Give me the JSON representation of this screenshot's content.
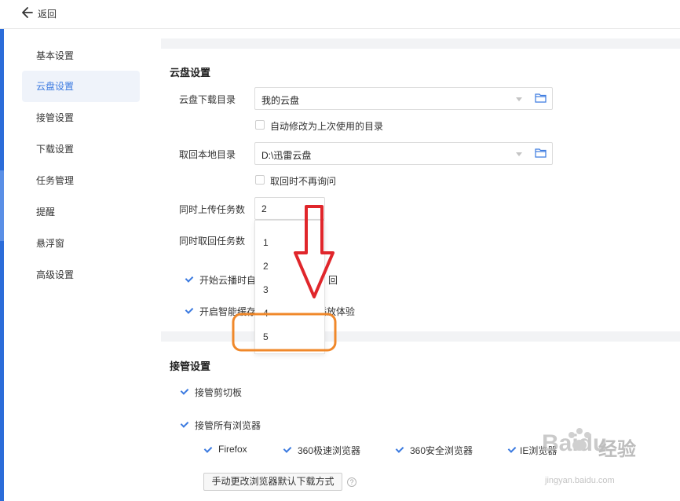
{
  "header": {
    "back_label": "返回"
  },
  "sidebar": {
    "items": [
      {
        "label": "基本设置",
        "active": false
      },
      {
        "label": "云盘设置",
        "active": true
      },
      {
        "label": "接管设置",
        "active": false
      },
      {
        "label": "下载设置",
        "active": false
      },
      {
        "label": "任务管理",
        "active": false
      },
      {
        "label": "提醒",
        "active": false
      },
      {
        "label": "悬浮窗",
        "active": false
      },
      {
        "label": "高级设置",
        "active": false
      }
    ]
  },
  "cloud": {
    "title": "云盘设置",
    "download_dir": {
      "label": "云盘下载目录",
      "value": "我的云盘"
    },
    "auto_modify": {
      "label": "自动修改为上次使用的目录",
      "checked": false
    },
    "local_dir": {
      "label": "取回本地目录",
      "value": "D:\\迅雷云盘"
    },
    "no_ask": {
      "label": "取回时不再询问",
      "checked": false
    },
    "upload_tasks": {
      "label": "同时上传任务数",
      "value": "2"
    },
    "retrieve_tasks": {
      "label": "同时取回任务数"
    },
    "start_play": {
      "label_left": "开始云播时自",
      "label_right": "回",
      "checked": true
    },
    "smart_cache": {
      "label_left": "开启智能缓存",
      "label_right": "播放体验",
      "checked": true
    },
    "dropdown_options": [
      "1",
      "2",
      "3",
      "4",
      "5"
    ]
  },
  "takeover": {
    "title": "接管设置",
    "clipboard": {
      "label": "接管剪切板",
      "checked": true
    },
    "all_browsers": {
      "label": "接管所有浏览器",
      "checked": true
    },
    "browsers": [
      {
        "label": "Firefox",
        "checked": true
      },
      {
        "label": "360极速浏览器",
        "checked": true
      },
      {
        "label": "360安全浏览器",
        "checked": true
      },
      {
        "label": "IE浏览器",
        "checked": true
      }
    ],
    "manual_button": "手动更改浏览器默认下载方式",
    "help": "?"
  },
  "watermark": {
    "brand": "Baidu",
    "cn": "经验",
    "url": "jingyan.baidu.com"
  },
  "colors": {
    "accent": "#3b7ae0",
    "arrow": "#e0262b",
    "highlight": "#f0882a"
  }
}
